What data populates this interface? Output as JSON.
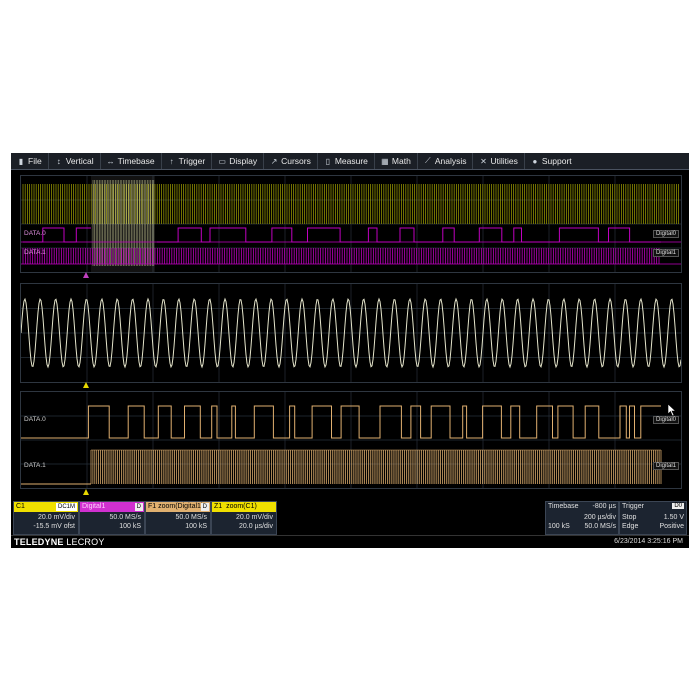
{
  "menu": [
    {
      "label": "File",
      "icon": "file-icon",
      "glyph": "▮"
    },
    {
      "label": "Vertical",
      "icon": "vertical-icon",
      "glyph": "↕"
    },
    {
      "label": "Timebase",
      "icon": "timebase-icon",
      "glyph": "↔"
    },
    {
      "label": "Trigger",
      "icon": "trigger-icon",
      "glyph": "↑"
    },
    {
      "label": "Display",
      "icon": "display-icon",
      "glyph": "▭"
    },
    {
      "label": "Cursors",
      "icon": "cursors-icon",
      "glyph": "↗"
    },
    {
      "label": "Measure",
      "icon": "measure-icon",
      "glyph": "▯"
    },
    {
      "label": "Math",
      "icon": "math-icon",
      "glyph": "▦"
    },
    {
      "label": "Analysis",
      "icon": "analysis-icon",
      "glyph": "⟋"
    },
    {
      "label": "Utilities",
      "icon": "utilities-icon",
      "glyph": "✕"
    },
    {
      "label": "Support",
      "icon": "support-icon",
      "glyph": "●"
    }
  ],
  "grid1": {
    "label_data0": "DATA.0",
    "label_data1": "DATA.1",
    "tag0": "Digital0",
    "tag1": "Digital1"
  },
  "grid3": {
    "label_data0": "DATA.0",
    "label_data1": "DATA.1",
    "tag0": "Digital0",
    "tag1": "Digital1"
  },
  "descriptors": {
    "c1": {
      "name": "C1",
      "badge": "DC1M",
      "line1": "20.0 mV/div",
      "line2": "-15.5 mV ofst"
    },
    "digital1": {
      "name": "Digital1",
      "badge": "D",
      "line1": "50.0 MS/s",
      "line2": "100 kS"
    },
    "fzoom": {
      "name": "F1 zoom(Digital1)",
      "badge": "D",
      "line1": "50.0 MS/s",
      "line2": "100 kS"
    },
    "z1": {
      "name": "Z1",
      "sub": "zoom(C1)",
      "line1": "20.0 mV/div",
      "line2": "20.0 µs/div"
    }
  },
  "timebase": {
    "label": "Timebase",
    "offset": "-800 µs",
    "div": "200 µs/div",
    "samples": "100 kS",
    "rate": "50.0 MS/s"
  },
  "trigger": {
    "label": "Trigger",
    "badge": "D0",
    "mode": "Stop",
    "level": "1.50 V",
    "type": "Edge",
    "slope": "Positive"
  },
  "footer": {
    "brand_bold": "TELEDYNE",
    "brand_rest": "LECROY",
    "datetime": "6/23/2014 3:25:16 PM"
  },
  "colors": {
    "digital_mix": "#a8a800",
    "magenta": "#c000c0",
    "analog": "#e6e6cc",
    "zoom_digital": "#e0b070",
    "c1": "#f0e000",
    "d1": "#e040e0"
  }
}
